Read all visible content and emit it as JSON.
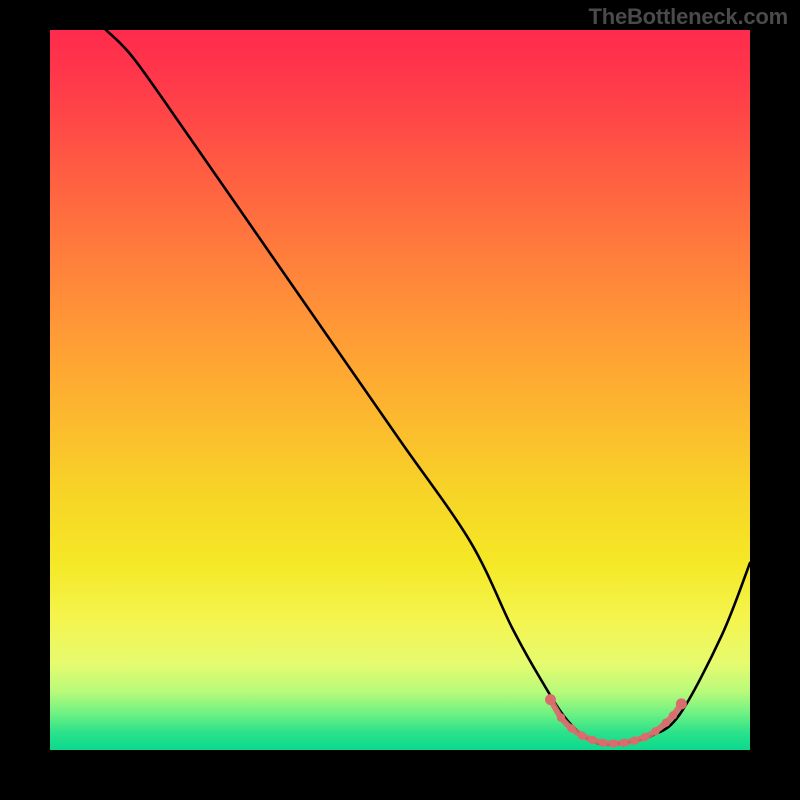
{
  "attribution": "TheBottleneck.com",
  "chart_data": {
    "type": "line",
    "title": "",
    "xlabel": "",
    "ylabel": "",
    "xlim": [
      0,
      100
    ],
    "ylim": [
      0,
      100
    ],
    "series": [
      {
        "name": "curve",
        "color": "#000000",
        "x": [
          8,
          12,
          20,
          30,
          40,
          50,
          60,
          66,
          70,
          74,
          78,
          82,
          86,
          90,
          96,
          100
        ],
        "values": [
          100,
          96,
          85,
          71,
          57,
          43,
          29,
          17,
          10,
          4,
          1,
          1,
          2,
          5,
          16,
          26
        ]
      }
    ],
    "highlight": {
      "name": "optimal-zone",
      "color": "#d96d6d",
      "points": [
        {
          "x": 71.5,
          "y": 7.0
        },
        {
          "x": 73.0,
          "y": 4.5
        },
        {
          "x": 74.5,
          "y": 3.0
        },
        {
          "x": 76.0,
          "y": 2.0
        },
        {
          "x": 77.5,
          "y": 1.4
        },
        {
          "x": 79.0,
          "y": 1.0
        },
        {
          "x": 80.5,
          "y": 0.9
        },
        {
          "x": 82.0,
          "y": 1.0
        },
        {
          "x": 83.5,
          "y": 1.3
        },
        {
          "x": 85.0,
          "y": 1.8
        },
        {
          "x": 86.5,
          "y": 2.6
        },
        {
          "x": 88.0,
          "y": 3.8
        },
        {
          "x": 89.0,
          "y": 4.8
        },
        {
          "x": 90.2,
          "y": 6.4
        }
      ]
    },
    "gradient_colors_top_to_bottom": [
      "#ff2a4d",
      "#ff7a3d",
      "#fcb92e",
      "#f5e826",
      "#b7fa7b",
      "#0ad98e"
    ]
  }
}
